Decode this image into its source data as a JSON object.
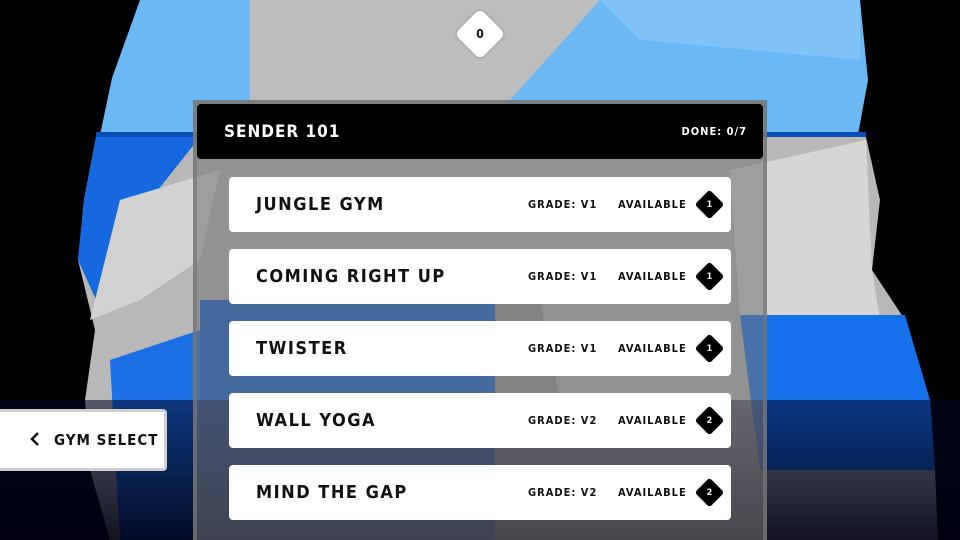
{
  "counter": {
    "value": "0"
  },
  "panel": {
    "title": "SENDER 101",
    "done_label": "DONE: 0/7"
  },
  "routes": [
    {
      "name": "JUNGLE GYM",
      "grade": "GRADE: V1",
      "status": "AVAILABLE",
      "badge": "1"
    },
    {
      "name": "COMING RIGHT UP",
      "grade": "GRADE: V1",
      "status": "AVAILABLE",
      "badge": "1"
    },
    {
      "name": "TWISTER",
      "grade": "GRADE: V1",
      "status": "AVAILABLE",
      "badge": "1"
    },
    {
      "name": "WALL YOGA",
      "grade": "GRADE: V2",
      "status": "AVAILABLE",
      "badge": "2"
    },
    {
      "name": "MIND THE GAP",
      "grade": "GRADE: V2",
      "status": "AVAILABLE",
      "badge": "2"
    }
  ],
  "back_button": {
    "icon": "chevron-left-icon",
    "label": "GYM SELECT"
  },
  "colors": {
    "sky_blue": "#6bb8f5",
    "wall_blue": "#0b63d8",
    "wall_gray": "#b4b4b4",
    "dark_navy": "#030a35"
  }
}
